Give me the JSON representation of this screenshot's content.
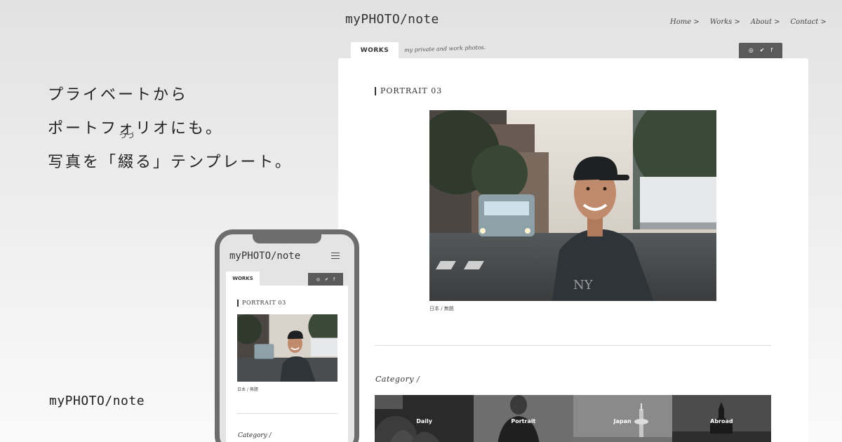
{
  "headline": {
    "line1": "プライベートから",
    "line2": "ポートフォリオにも。",
    "line3_prefix": "写真を「",
    "line3_kanji": "綴",
    "line3_ruby": "つづ",
    "line3_suffix": "る」テンプレート。"
  },
  "brand": "myPHOTO/note",
  "site": {
    "logo": "myPHOTO/note",
    "nav": [
      "Home >",
      "Works >",
      "About >",
      "Contact >"
    ],
    "tab": "WORKS",
    "tagline": "my private and work photos.",
    "social_icons": [
      "instagram-icon",
      "twitter-icon",
      "facebook-icon"
    ],
    "social_glyphs": [
      "◎",
      "✔",
      "f"
    ]
  },
  "post": {
    "title": "PORTRAIT 03",
    "caption": "日本 / 無題"
  },
  "category": {
    "title": "Category /",
    "items": [
      "Daily",
      "Portrait",
      "Japan",
      "Abroad"
    ]
  },
  "phone": {
    "logo": "myPHOTO/note",
    "tab": "WORKS",
    "title": "PORTRAIT 03",
    "caption": "日本 / 無題",
    "category_title": "Category /"
  },
  "colors": {
    "dark_tab": "#5a5a5a",
    "phone_frame": "#6d6d6d",
    "card": "#ffffff"
  }
}
